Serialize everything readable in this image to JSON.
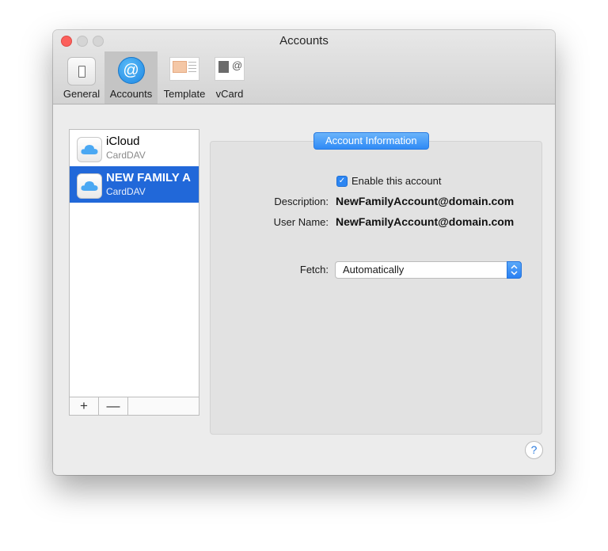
{
  "window": {
    "title": "Accounts"
  },
  "toolbar": {
    "tabs": [
      {
        "label": "General",
        "icon": "switch-icon",
        "selected": false
      },
      {
        "label": "Accounts",
        "icon": "at-sign-icon",
        "selected": true
      },
      {
        "label": "Template",
        "icon": "template-card-icon",
        "selected": false
      },
      {
        "label": "vCard",
        "icon": "vcard-icon",
        "selected": false
      }
    ]
  },
  "accounts": [
    {
      "name": "iCloud",
      "type": "CardDAV",
      "icon": "icloud-icon",
      "selected": false
    },
    {
      "name": "NEW FAMILY A",
      "type": "CardDAV",
      "icon": "icloud-icon",
      "selected": true
    }
  ],
  "list_controls": {
    "add": "+",
    "remove": "—"
  },
  "info": {
    "section_title": "Account Information",
    "enable_label": "Enable this account",
    "enable_checked": true,
    "description_label": "Description:",
    "description_value": "NewFamilyAccount@domain.com",
    "username_label": "User Name:",
    "username_value": "NewFamilyAccount@domain.com",
    "fetch_label": "Fetch:",
    "fetch_value": "Automatically"
  },
  "help": "?",
  "colors": {
    "selection": "#2168d9",
    "accent": "#2f8af6",
    "close": "#fc605c"
  }
}
